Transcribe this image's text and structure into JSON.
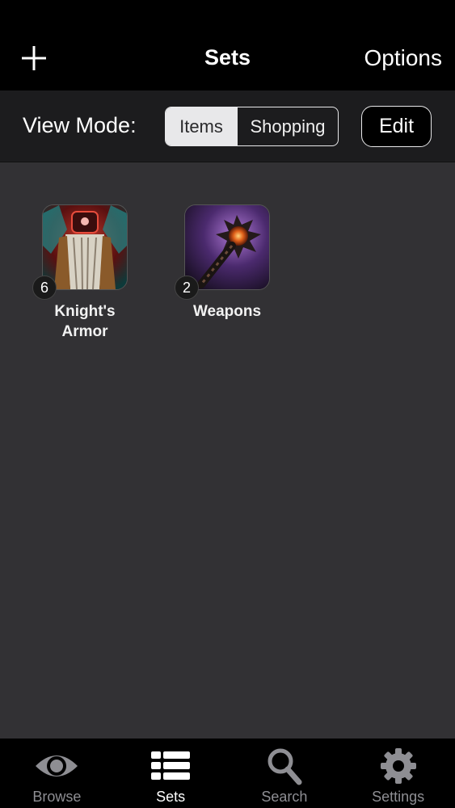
{
  "nav": {
    "title": "Sets",
    "options_label": "Options",
    "add_icon": "plus-icon"
  },
  "toolbar": {
    "view_mode_label": "View Mode:",
    "segments": [
      "Items",
      "Shopping"
    ],
    "selected_segment": "Items",
    "edit_label": "Edit"
  },
  "sets": [
    {
      "name": "Knight's\nArmor",
      "count": "6",
      "icon": "armor-icon"
    },
    {
      "name": "Weapons",
      "count": "2",
      "icon": "weapon-icon"
    }
  ],
  "tabs": [
    {
      "label": "Browse",
      "icon": "eye-icon",
      "active": false
    },
    {
      "label": "Sets",
      "icon": "list-icon",
      "active": true
    },
    {
      "label": "Search",
      "icon": "search-icon",
      "active": false
    },
    {
      "label": "Settings",
      "icon": "gear-icon",
      "active": false
    }
  ],
  "colors": {
    "background": "#323134",
    "bar": "#000000",
    "inactive_tab": "#8e8e93"
  }
}
